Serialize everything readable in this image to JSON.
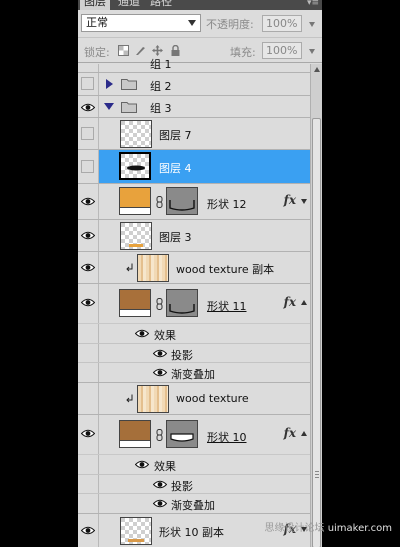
{
  "tabs": [
    {
      "label": "图层",
      "active": true
    },
    {
      "label": "通道",
      "active": false
    },
    {
      "label": "路径",
      "active": false
    }
  ],
  "blend": {
    "mode": "正常",
    "opacity_label": "不透明度:",
    "opacity_value": "100%"
  },
  "lock": {
    "label": "锁定:",
    "fill_label": "填充:",
    "fill_value": "100%"
  },
  "layers": {
    "group_prev": "组 1",
    "group2": "组 2",
    "group3": "组 3",
    "layer7": "图层 7",
    "layer4": "图层 4",
    "shape12": "形状 12",
    "layer3": "图层 3",
    "wood_copy": "wood texture 副本",
    "shape11": "形状 11",
    "effects": "效果",
    "drop_shadow": "投影",
    "gradient_overlay": "渐变叠加",
    "wood": "wood texture",
    "shape10": "形状 10",
    "effects2": "效果",
    "drop_shadow2": "投影",
    "gradient_overlay2": "渐变叠加",
    "shape10_copy": "形状 10 副本",
    "fx": "fx"
  },
  "colors": {
    "selected": "#3aa0f2",
    "orange_swatch": "#e8a23c",
    "brown_swatch": "#a8703a",
    "brown_swatch2": "#a56f3a"
  },
  "watermark": {
    "prefix": "思缘设计论坛 ",
    "text": "uimaker.com"
  }
}
